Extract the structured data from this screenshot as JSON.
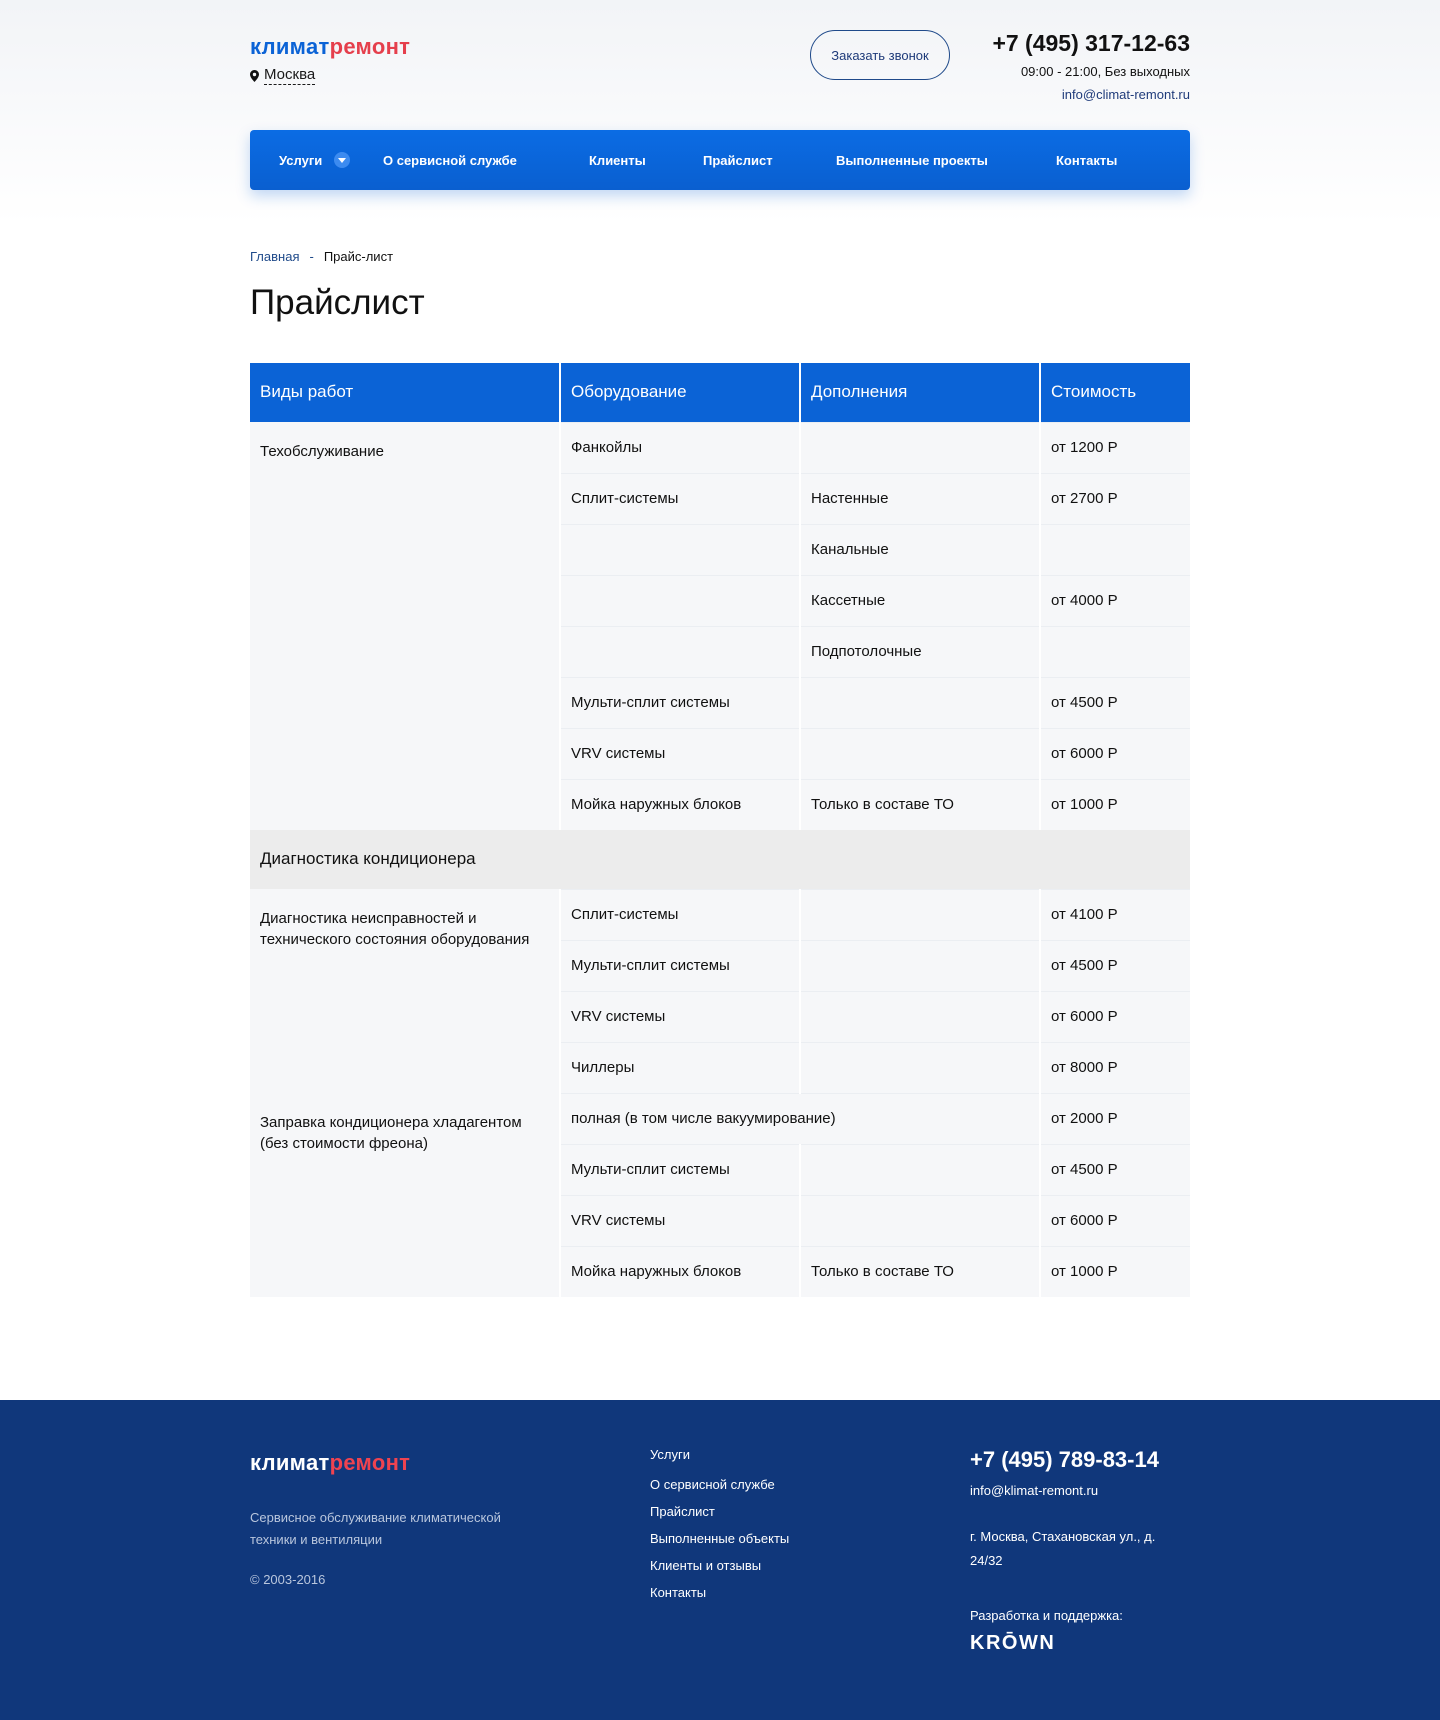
{
  "header": {
    "logo_part1": "климат",
    "logo_part2": "ремонт",
    "city": "Москва",
    "callback_label": "Заказать звонок",
    "phone": "+7 (495) 317-12-63",
    "hours": "09:00 - 21:00, Без выходных",
    "email": "info@climat-remont.ru"
  },
  "nav": {
    "items": [
      {
        "label": "Услуги"
      },
      {
        "label": "О сервисной службе"
      },
      {
        "label": "Клиенты"
      },
      {
        "label": "Прайслист"
      },
      {
        "label": "Выполненные проекты"
      },
      {
        "label": "Контакты"
      }
    ]
  },
  "breadcrumb": {
    "home": "Главная",
    "separator": "-",
    "current": "Прайс-лист"
  },
  "page_title": "Прайслист",
  "table": {
    "headers": [
      "Виды работ",
      "Оборудование",
      "Дополнения",
      "Стоимость"
    ],
    "group1": {
      "label": "Техобслуживание",
      "rows": [
        {
          "equipment": "Фанкойлы",
          "extra": "",
          "price": "от 1200 Р"
        },
        {
          "equipment": "Сплит-системы",
          "extra": "Настенные",
          "price": "от 2700 Р"
        },
        {
          "equipment": "",
          "extra": "Канальные",
          "price": ""
        },
        {
          "equipment": "",
          "extra": "Кассетные",
          "price": "от 4000 Р"
        },
        {
          "equipment": "",
          "extra": "Подпотолочные",
          "price": ""
        },
        {
          "equipment": "Мульти-сплит системы",
          "extra": "",
          "price": "от 4500 Р"
        },
        {
          "equipment": "VRV системы",
          "extra": "",
          "price": "от 6000 Р"
        },
        {
          "equipment": "Мойка наружных блоков",
          "extra": "Только в составе ТО",
          "price": "от 1000 Р"
        }
      ]
    },
    "section": "Диагностика кондиционера",
    "group2": {
      "label": "Диагностика неисправностей и технического состояния оборудования",
      "rows": [
        {
          "equipment": "Сплит-системы",
          "extra": "",
          "price": "от 4100 Р"
        },
        {
          "equipment": "Мульти-сплит системы",
          "extra": "",
          "price": "от 4500 Р"
        },
        {
          "equipment": "VRV системы",
          "extra": "",
          "price": "от 6000 Р"
        },
        {
          "equipment": "Чиллеры",
          "extra": "",
          "price": "от 8000 Р"
        }
      ]
    },
    "group3": {
      "label": "Заправка кондиционера хладагентом (без стоимости фреона)",
      "first_row": {
        "equipment": "полная (в том числе вакуумирование)",
        "price": "от 2000 Р"
      },
      "rows": [
        {
          "equipment": "Мульти-сплит системы",
          "extra": "",
          "price": "от 4500 Р"
        },
        {
          "equipment": "VRV системы",
          "extra": "",
          "price": "от 6000 Р"
        },
        {
          "equipment": "Мойка наружных блоков",
          "extra": "Только в составе ТО",
          "price": "от 1000 Р"
        }
      ]
    }
  },
  "footer": {
    "logo_part1": "климат",
    "logo_part2": "ремонт",
    "description": "Сервисное обслуживание климатической техники и вентиляции",
    "copyright": "© 2003-2016",
    "links": [
      {
        "label": "Услуги"
      },
      {
        "label": "О сервисной службе"
      },
      {
        "label": "Прайслист"
      },
      {
        "label": "Выполненные объекты"
      },
      {
        "label": "Клиенты и отзывы"
      },
      {
        "label": "Контакты"
      }
    ],
    "phone": "+7 (495) 789-83-14",
    "email": "info@klimat-remont.ru",
    "address": "г. Москва, Стахановская ул., д. 24/32",
    "dev_label": "Разработка и поддержка:",
    "dev_brand": "KRŌWN"
  },
  "colors": {
    "brand_blue": "#0b63d6",
    "brand_red": "#e53f4c",
    "footer_bg": "#10377b"
  }
}
